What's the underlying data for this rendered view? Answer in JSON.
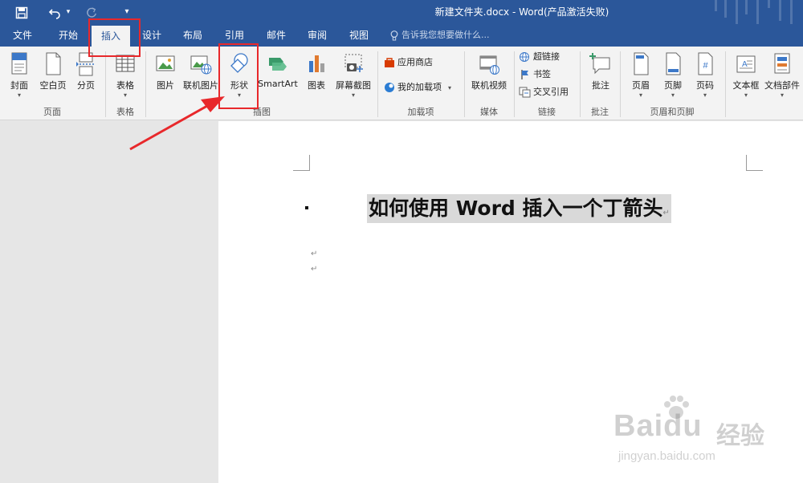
{
  "window": {
    "title": "新建文件夹.docx - Word(产品激活失败)"
  },
  "tabs": [
    {
      "label": "文件"
    },
    {
      "label": "开始"
    },
    {
      "label": "插入"
    },
    {
      "label": "设计"
    },
    {
      "label": "布局"
    },
    {
      "label": "引用"
    },
    {
      "label": "邮件"
    },
    {
      "label": "审阅"
    },
    {
      "label": "视图"
    }
  ],
  "tell_me": "告诉我您想要做什么...",
  "ribbon": {
    "groups": {
      "pages": "页面",
      "tables": "表格",
      "illustrations": "插图",
      "addins": "加载项",
      "media": "媒体",
      "links": "链接",
      "comments": "批注",
      "header_footer": "页眉和页脚"
    },
    "buttons": {
      "cover": "封面",
      "blank": "空白页",
      "pagebreak": "分页",
      "table": "表格",
      "picture": "图片",
      "online_picture": "联机图片",
      "shapes": "形状",
      "smartart": "SmartArt",
      "chart": "图表",
      "screenshot": "屏幕截图",
      "store": "应用商店",
      "my_addins": "我的加载项",
      "online_video": "联机视频",
      "hyperlink": "超链接",
      "bookmark": "书签",
      "crossref": "交叉引用",
      "comment": "批注",
      "header": "页眉",
      "footer": "页脚",
      "pagenum": "页码",
      "textbox": "文本框",
      "quickparts": "文档部件"
    }
  },
  "document": {
    "heading": "如何使用 Word 插入一个丁箭头",
    "para_mark": "↵"
  },
  "watermark": {
    "brand": "Baidu",
    "brand_cn": "经验",
    "url": "jingyan.baidu.com"
  },
  "colors": {
    "word_blue": "#2b579a",
    "highlight_red": "#e8282b"
  }
}
